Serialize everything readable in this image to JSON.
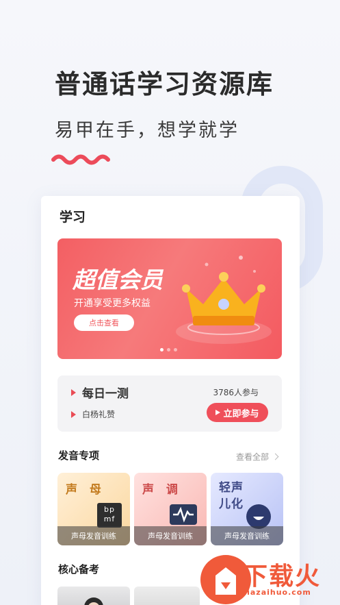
{
  "hero": {
    "title": "普通话学习资源库",
    "subtitle": "易甲在手，想学就学"
  },
  "card": {
    "title": "学习",
    "banner": {
      "title": "超值会员",
      "subtitle": "开通享受更多权益",
      "button": "点击查看",
      "accent": "#f35f63"
    },
    "daily": {
      "title": "每日一测",
      "participants": "3786人参与",
      "author": "白杨礼赞",
      "button": "立即参与"
    },
    "pronunciation": {
      "heading": "发音专项",
      "see_all": "查看全部",
      "tiles": [
        {
          "name": "声 母",
          "icon_text": "bp mf",
          "footer": "声母发音训练",
          "icon": "bpmf-icon"
        },
        {
          "name": "声 调",
          "footer": "声母发音训练",
          "icon": "waveform-icon"
        },
        {
          "name": "轻声 儿化",
          "footer": "声母发音训练",
          "icon": "smile-icon"
        }
      ]
    },
    "core": {
      "heading": "核心备考"
    }
  },
  "watermark": {
    "text": "下载火",
    "url": "xiazaihuo.com"
  }
}
